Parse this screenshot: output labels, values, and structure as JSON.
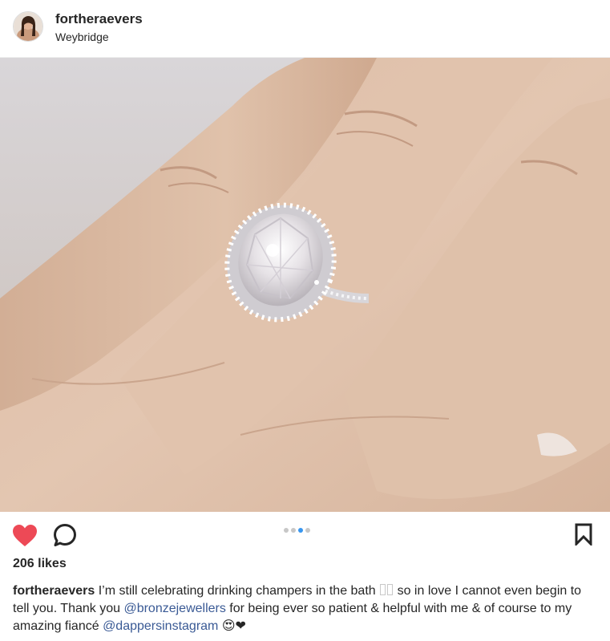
{
  "header": {
    "username": "fortheraevers",
    "location": "Weybridge"
  },
  "post": {
    "carousel": {
      "dot_count": 4,
      "active_index": 2
    },
    "likes": "206 likes",
    "caption": {
      "username": "fortheraevers",
      "text_1": " I’m still celebrating drinking champers in the bath ",
      "text_2": " so in love I cannot even begin to tell you. Thank you ",
      "mention_1": "@bronzejewellers",
      "text_3": " for being ever so patient & helpful with me & of course to my amazing fiancé ",
      "mention_2": "@dappersinstagram",
      "emoji": " 😍❤"
    }
  },
  "icons": {
    "like": "heart-icon",
    "comment": "comment-icon",
    "save": "bookmark-icon"
  },
  "colors": {
    "heart": "#ed4956",
    "active_dot": "#3897f0",
    "inactive_dot": "#c7c7c7",
    "mention": "#3a5a95"
  }
}
